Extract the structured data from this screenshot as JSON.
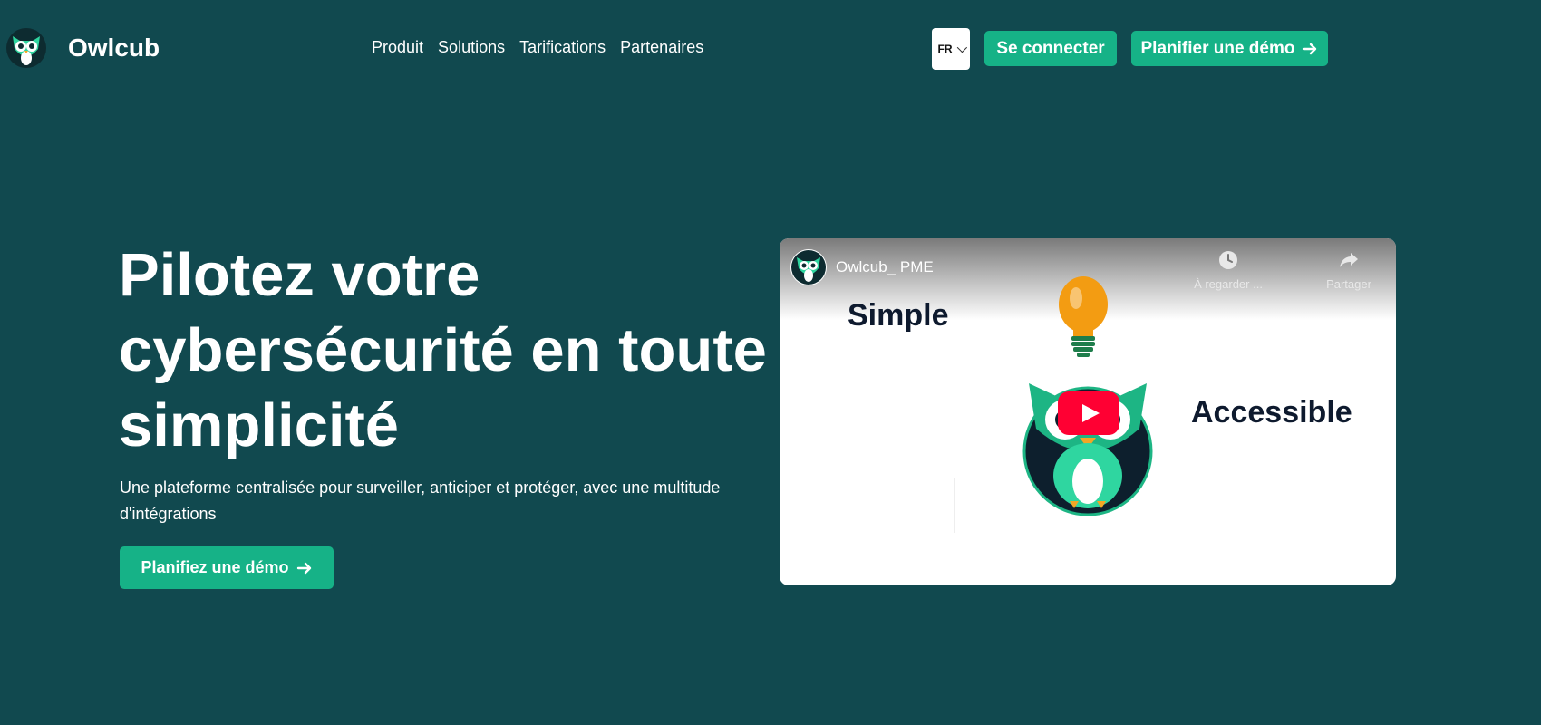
{
  "header": {
    "brand": "Owlcub",
    "nav": [
      {
        "label": "Produit"
      },
      {
        "label": "Solutions"
      },
      {
        "label": "Tarifications"
      },
      {
        "label": "Partenaires"
      }
    ],
    "lang": "FR",
    "login_label": "Se connecter",
    "demo_label": "Planifier une démo"
  },
  "hero": {
    "title": "Pilotez votre cybersécurité en toute simplicité",
    "subtitle": "Une plateforme centralisée pour surveiller, anticiper et protéger, avec une multitude d'intégrations",
    "cta_label": "Planifiez une démo"
  },
  "video": {
    "channel_title": "Owlcub_ PME",
    "watch_later_label": "À regarder ...",
    "share_label": "Partager",
    "word_left": "Simple",
    "word_right": "Accessible"
  },
  "colors": {
    "background": "#11494f",
    "accent": "#16b287",
    "youtube_red": "#ff0033"
  },
  "icons": [
    "owl-logo-icon",
    "chevron-down-icon",
    "arrow-right-icon",
    "clock-icon",
    "share-icon",
    "play-icon",
    "lightbulb-icon"
  ]
}
